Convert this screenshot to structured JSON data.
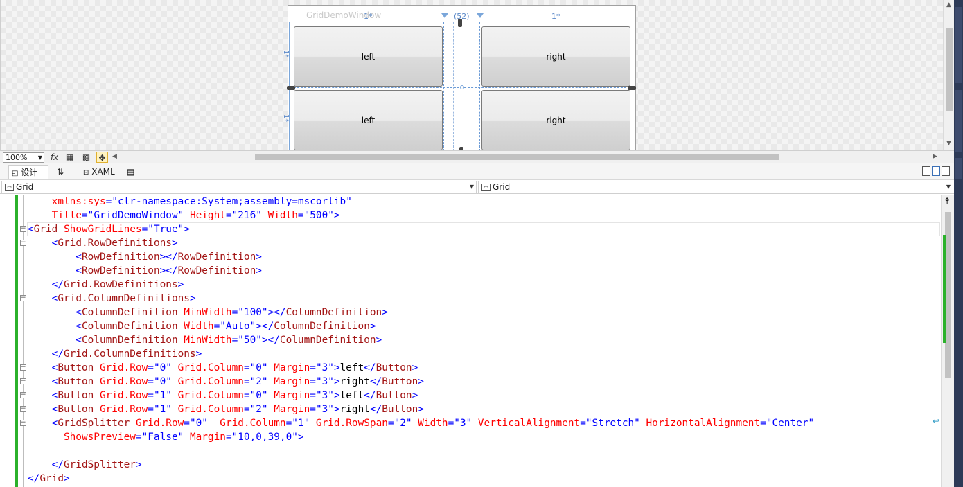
{
  "designer": {
    "window_title": "GridDemoWindow",
    "column_labels": [
      "1*",
      "(52)",
      "1*"
    ],
    "row_labels": [
      "1*",
      "1*"
    ],
    "buttons": [
      "left",
      "right",
      "left",
      "right"
    ]
  },
  "design_toolbar": {
    "zoom": "100%",
    "fx_icon": "fx"
  },
  "pane_tabs": {
    "design": "设计",
    "swap": "⇅",
    "xaml": "XAML"
  },
  "nav": {
    "left": "Grid",
    "right": "Grid"
  },
  "editor": {
    "lines": [
      [
        [
          "a",
          "    xmlns:sys"
        ],
        [
          "b",
          "="
        ],
        [
          "v",
          "\"clr-namespace:System;assembly=mscorlib\""
        ]
      ],
      [
        [
          "a",
          "    Title"
        ],
        [
          "b",
          "="
        ],
        [
          "v",
          "\"GridDemoWindow\""
        ],
        [
          "a",
          " Height"
        ],
        [
          "b",
          "="
        ],
        [
          "v",
          "\"216\""
        ],
        [
          "a",
          " Width"
        ],
        [
          "b",
          "="
        ],
        [
          "v",
          "\"500\""
        ],
        [
          "b",
          ">"
        ]
      ],
      [
        [
          "b",
          "<"
        ],
        [
          "t",
          "Grid"
        ],
        [
          "a",
          " ShowGridLines"
        ],
        [
          "b",
          "="
        ],
        [
          "v",
          "\"True\""
        ],
        [
          "b",
          ">"
        ]
      ],
      [
        [
          "b",
          "    <"
        ],
        [
          "t",
          "Grid.RowDefinitions"
        ],
        [
          "b",
          ">"
        ]
      ],
      [
        [
          "b",
          "        <"
        ],
        [
          "t",
          "RowDefinition"
        ],
        [
          "b",
          "></"
        ],
        [
          "t",
          "RowDefinition"
        ],
        [
          "b",
          ">"
        ]
      ],
      [
        [
          "b",
          "        <"
        ],
        [
          "t",
          "RowDefinition"
        ],
        [
          "b",
          "></"
        ],
        [
          "t",
          "RowDefinition"
        ],
        [
          "b",
          ">"
        ]
      ],
      [
        [
          "b",
          "    </"
        ],
        [
          "t",
          "Grid.RowDefinitions"
        ],
        [
          "b",
          ">"
        ]
      ],
      [
        [
          "b",
          "    <"
        ],
        [
          "t",
          "Grid.ColumnDefinitions"
        ],
        [
          "b",
          ">"
        ]
      ],
      [
        [
          "b",
          "        <"
        ],
        [
          "t",
          "ColumnDefinition"
        ],
        [
          "a",
          " MinWidth"
        ],
        [
          "b",
          "="
        ],
        [
          "v",
          "\"100\""
        ],
        [
          "b",
          "></"
        ],
        [
          "t",
          "ColumnDefinition"
        ],
        [
          "b",
          ">"
        ]
      ],
      [
        [
          "b",
          "        <"
        ],
        [
          "t",
          "ColumnDefinition"
        ],
        [
          "a",
          " Width"
        ],
        [
          "b",
          "="
        ],
        [
          "v",
          "\"Auto\""
        ],
        [
          "b",
          "></"
        ],
        [
          "t",
          "ColumnDefinition"
        ],
        [
          "b",
          ">"
        ]
      ],
      [
        [
          "b",
          "        <"
        ],
        [
          "t",
          "ColumnDefinition"
        ],
        [
          "a",
          " MinWidth"
        ],
        [
          "b",
          "="
        ],
        [
          "v",
          "\"50\""
        ],
        [
          "b",
          "></"
        ],
        [
          "t",
          "ColumnDefinition"
        ],
        [
          "b",
          ">"
        ]
      ],
      [
        [
          "b",
          "    </"
        ],
        [
          "t",
          "Grid.ColumnDefinitions"
        ],
        [
          "b",
          ">"
        ]
      ],
      [
        [
          "b",
          "    <"
        ],
        [
          "t",
          "Button"
        ],
        [
          "a",
          " Grid.Row"
        ],
        [
          "b",
          "="
        ],
        [
          "v",
          "\"0\""
        ],
        [
          "a",
          " Grid.Column"
        ],
        [
          "b",
          "="
        ],
        [
          "v",
          "\"0\""
        ],
        [
          "a",
          " Margin"
        ],
        [
          "b",
          "="
        ],
        [
          "v",
          "\"3\""
        ],
        [
          "b",
          ">"
        ],
        [
          "x",
          "left"
        ],
        [
          "b",
          "</"
        ],
        [
          "t",
          "Button"
        ],
        [
          "b",
          ">"
        ]
      ],
      [
        [
          "b",
          "    <"
        ],
        [
          "t",
          "Button"
        ],
        [
          "a",
          " Grid.Row"
        ],
        [
          "b",
          "="
        ],
        [
          "v",
          "\"0\""
        ],
        [
          "a",
          " Grid.Column"
        ],
        [
          "b",
          "="
        ],
        [
          "v",
          "\"2\""
        ],
        [
          "a",
          " Margin"
        ],
        [
          "b",
          "="
        ],
        [
          "v",
          "\"3\""
        ],
        [
          "b",
          ">"
        ],
        [
          "x",
          "right"
        ],
        [
          "b",
          "</"
        ],
        [
          "t",
          "Button"
        ],
        [
          "b",
          ">"
        ]
      ],
      [
        [
          "b",
          "    <"
        ],
        [
          "t",
          "Button"
        ],
        [
          "a",
          " Grid.Row"
        ],
        [
          "b",
          "="
        ],
        [
          "v",
          "\"1\""
        ],
        [
          "a",
          " Grid.Column"
        ],
        [
          "b",
          "="
        ],
        [
          "v",
          "\"0\""
        ],
        [
          "a",
          " Margin"
        ],
        [
          "b",
          "="
        ],
        [
          "v",
          "\"3\""
        ],
        [
          "b",
          ">"
        ],
        [
          "x",
          "left"
        ],
        [
          "b",
          "</"
        ],
        [
          "t",
          "Button"
        ],
        [
          "b",
          ">"
        ]
      ],
      [
        [
          "b",
          "    <"
        ],
        [
          "t",
          "Button"
        ],
        [
          "a",
          " Grid.Row"
        ],
        [
          "b",
          "="
        ],
        [
          "v",
          "\"1\""
        ],
        [
          "a",
          " Grid.Column"
        ],
        [
          "b",
          "="
        ],
        [
          "v",
          "\"2\""
        ],
        [
          "a",
          " Margin"
        ],
        [
          "b",
          "="
        ],
        [
          "v",
          "\"3\""
        ],
        [
          "b",
          ">"
        ],
        [
          "x",
          "right"
        ],
        [
          "b",
          "</"
        ],
        [
          "t",
          "Button"
        ],
        [
          "b",
          ">"
        ]
      ],
      [
        [
          "b",
          "    <"
        ],
        [
          "t",
          "GridSplitter"
        ],
        [
          "a",
          " Grid.Row"
        ],
        [
          "b",
          "="
        ],
        [
          "v",
          "\"0\""
        ],
        [
          "a",
          "  Grid.Column"
        ],
        [
          "b",
          "="
        ],
        [
          "v",
          "\"1\""
        ],
        [
          "a",
          " Grid.RowSpan"
        ],
        [
          "b",
          "="
        ],
        [
          "v",
          "\"2\""
        ],
        [
          "a",
          " Width"
        ],
        [
          "b",
          "="
        ],
        [
          "v",
          "\"3\""
        ],
        [
          "a",
          " VerticalAlignment"
        ],
        [
          "b",
          "="
        ],
        [
          "v",
          "\"Stretch\""
        ],
        [
          "a",
          " HorizontalAlignment"
        ],
        [
          "b",
          "="
        ],
        [
          "v",
          "\"Center\""
        ]
      ],
      [
        [
          "a",
          "      ShowsPreview"
        ],
        [
          "b",
          "="
        ],
        [
          "v",
          "\"False\""
        ],
        [
          "a",
          " Margin"
        ],
        [
          "b",
          "="
        ],
        [
          "v",
          "\"10,0,39,0\""
        ],
        [
          "b",
          ">"
        ]
      ],
      [
        [
          "x",
          ""
        ]
      ],
      [
        [
          "b",
          "    </"
        ],
        [
          "t",
          "GridSplitter"
        ],
        [
          "b",
          ">"
        ]
      ],
      [
        [
          "b",
          "</"
        ],
        [
          "t",
          "Grid"
        ],
        [
          "b",
          ">"
        ]
      ]
    ]
  }
}
